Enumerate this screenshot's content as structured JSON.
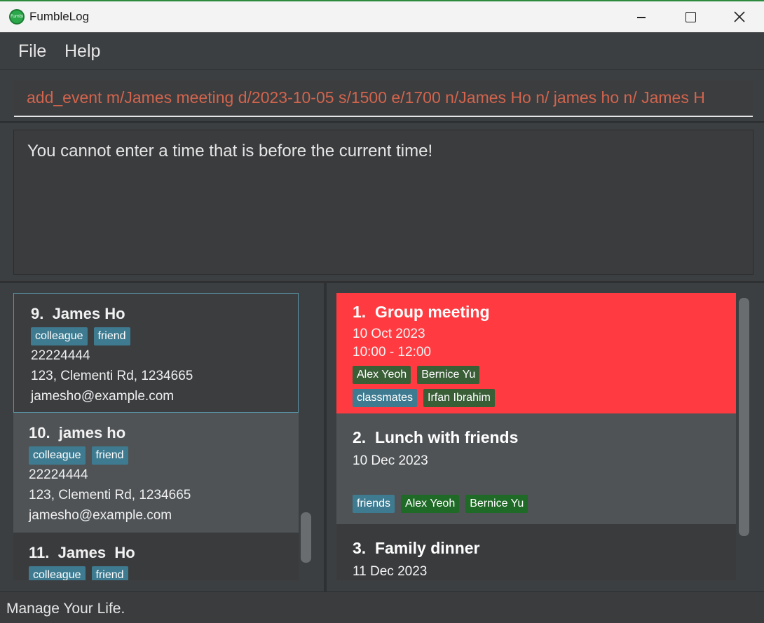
{
  "window": {
    "title": "FumbleLog",
    "app_icon_text": "FumbleLog"
  },
  "menu": {
    "file": "File",
    "help": "Help"
  },
  "command": {
    "value": "add_event m/James meeting d/2023-10-05 s/1500 e/1700 n/James Ho n/ james ho n/ James  H"
  },
  "result": {
    "text": "You cannot enter a time that is before the current time!"
  },
  "persons": [
    {
      "name": "9.  James Ho",
      "tags": [
        "colleague",
        "friend"
      ],
      "phone": "22224444",
      "address": "123, Clementi Rd, 1234665",
      "email": "jamesho@example.com"
    },
    {
      "name": "10.  james ho",
      "tags": [
        "colleague",
        "friend"
      ],
      "phone": "22224444",
      "address": "123, Clementi Rd, 1234665",
      "email": "jamesho@example.com"
    },
    {
      "name": "11.  James  Ho",
      "tags": [
        "colleague",
        "friend"
      ]
    }
  ],
  "events": [
    {
      "title": "1.  Group meeting",
      "date": "10 Oct 2023",
      "time": "10:00 - 12:00",
      "tags_row1": [
        "Alex Yeoh",
        "Bernice Yu"
      ],
      "tags_row2": [
        "classmates",
        "Irfan Ibrahim"
      ]
    },
    {
      "title": "2.  Lunch with friends",
      "date": "10 Dec 2023",
      "tags_row1": [
        "friends",
        "Alex Yeoh",
        "Bernice Yu"
      ]
    },
    {
      "title": "3.  Family dinner",
      "date": "11 Dec 2023"
    }
  ],
  "status": {
    "text": "Manage Your Life."
  },
  "colors": {
    "highlight_event": "#ff3b41",
    "group_tag": "#3e7b91",
    "person_tag": "#3a5f37",
    "command_text": "#d2644d"
  }
}
